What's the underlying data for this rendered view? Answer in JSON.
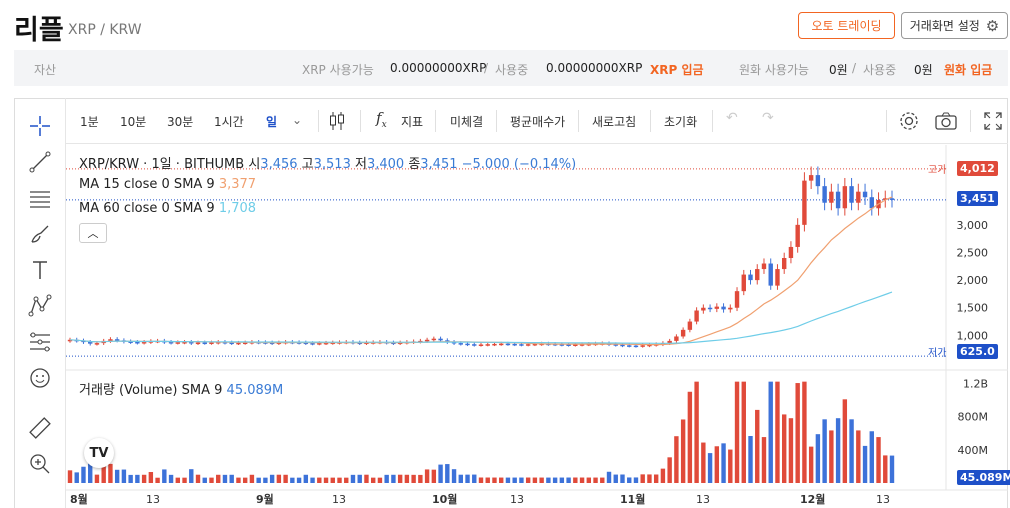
{
  "header": {
    "coin_name": "리플",
    "pair": "XRP / KRW",
    "auto_trade_label": "오토 트레이딩",
    "settings_label": "거래화면 설정"
  },
  "asset_bar": {
    "asset_label": "자산",
    "xrp_available_label": "XRP 사용가능",
    "xrp_available_value": "0.00000000XRP",
    "separator": "/",
    "in_use_label": "사용중",
    "xrp_in_use_value": "0.00000000XRP",
    "xrp_deposit_label": "XRP 입금",
    "krw_available_label": "원화 사용가능",
    "krw_available_value": "0원",
    "krw_in_use_value": "0원",
    "krw_deposit_label": "원화 입금"
  },
  "toolbar": {
    "intervals": [
      "1분",
      "10분",
      "30분",
      "1시간",
      "일"
    ],
    "active_interval": "일",
    "indicator_label": "지표",
    "fx_label": "f",
    "unfilled_label": "미체결",
    "avg_price_label": "평균매수가",
    "refresh_label": "새로고침",
    "reset_label": "초기화"
  },
  "legend": {
    "symbol": "XRP/KRW · 1일 · BITHUMB",
    "open_label": "시",
    "open_value": "3,456",
    "high_label": "고",
    "high_value": "3,513",
    "low_label": "저",
    "low_value": "3,400",
    "close_label": "종",
    "close_value": "3,451",
    "change_value": "−5.000 (−0.14%)",
    "ma15_label": "MA 15 close 0 SMA 9",
    "ma15_value": "3,377",
    "ma60_label": "MA 60 close 0 SMA 9",
    "ma60_value": "1,708",
    "volume_label": "거래량 (Volume) SMA 9",
    "volume_value": "45.089M"
  },
  "annotations": {
    "high_label": "고가",
    "high_price": "4,012",
    "low_label": "저가",
    "low_price": "625.0",
    "last_price": "3,451"
  },
  "colors": {
    "up": "#e04a3a",
    "down": "#3d72d9",
    "accent": "#f26522",
    "ma15": "#f0a070",
    "ma60": "#6fcde8",
    "active_blue": "#1e50c8"
  },
  "chart_data": {
    "type": "candlestick",
    "price_axis_ticks": [
      "3,000",
      "2,500",
      "2,000",
      "1,500",
      "1,000"
    ],
    "volume_axis_ticks": [
      "1.2B",
      "800M",
      "400M"
    ],
    "time_axis_labels": [
      "8월",
      "13",
      "9월",
      "13",
      "10월",
      "13",
      "11월",
      "13",
      "12월",
      "13"
    ],
    "ylim": [
      500,
      4300
    ],
    "closes": [
      920,
      905,
      880,
      850,
      860,
      900,
      930,
      910,
      890,
      880,
      870,
      880,
      895,
      900,
      880,
      870,
      875,
      880,
      860,
      870,
      865,
      870,
      880,
      870,
      860,
      865,
      870,
      880,
      875,
      870,
      860,
      870,
      880,
      875,
      870,
      860,
      855,
      860,
      865,
      870,
      875,
      880,
      870,
      860,
      870,
      875,
      880,
      870,
      860,
      870,
      880,
      890,
      900,
      920,
      940,
      910,
      880,
      860,
      850,
      840,
      830,
      835,
      840,
      845,
      850,
      845,
      840,
      835,
      840,
      845,
      850,
      845,
      840,
      835,
      830,
      835,
      840,
      845,
      850,
      855,
      840,
      830,
      820,
      815,
      810,
      820,
      830,
      840,
      860,
      900,
      980,
      1100,
      1250,
      1450,
      1500,
      1480,
      1520,
      1470,
      1500,
      1800,
      2100,
      2000,
      2200,
      2300,
      1900,
      2200,
      2400,
      2600,
      3000,
      3800,
      3900,
      3700,
      3400,
      3600,
      3300,
      3700,
      3400,
      3600,
      3500,
      3300,
      3450,
      3480,
      3451
    ]
  }
}
